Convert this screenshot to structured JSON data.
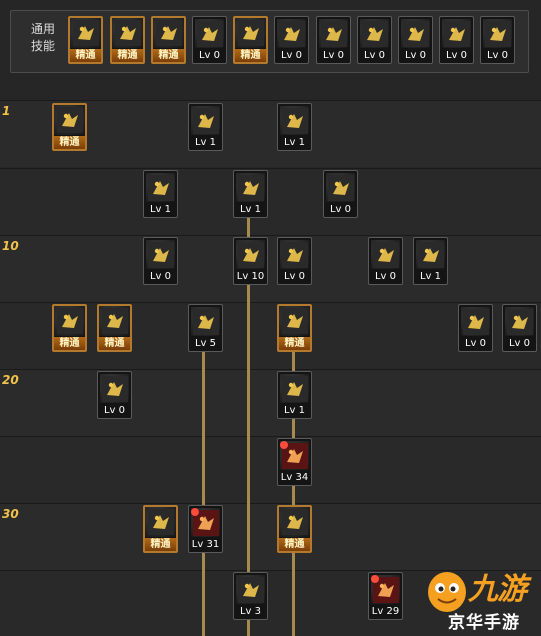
{
  "common_skills": {
    "label": "通用\n技能",
    "skills": [
      {
        "icon": "acrobat-icon",
        "tag": "精通",
        "mastered": true
      },
      {
        "icon": "leap-kick-icon",
        "tag": "精通",
        "mastered": true
      },
      {
        "icon": "dash-kick-icon",
        "tag": "精通",
        "mastered": true
      },
      {
        "icon": "wings-icon",
        "tag": "Lv 0",
        "mastered": false
      },
      {
        "icon": "target-icon",
        "tag": "精通",
        "mastered": true
      },
      {
        "icon": "crosshair-icon",
        "tag": "Lv 0",
        "mastered": false
      },
      {
        "icon": "grenade-throw-icon",
        "tag": "Lv 0",
        "mastered": false
      },
      {
        "icon": "gear-man-icon",
        "tag": "Lv 0",
        "mastered": false
      },
      {
        "icon": "eye-icon",
        "tag": "Lv 0",
        "mastered": false
      },
      {
        "icon": "aura-man-icon",
        "tag": "Lv 0",
        "mastered": false
      },
      {
        "icon": "whirl-kick-icon",
        "tag": "Lv 0",
        "mastered": false
      }
    ]
  },
  "rows": [
    {
      "level": "1"
    },
    {
      "level": ""
    },
    {
      "level": "10"
    },
    {
      "level": ""
    },
    {
      "level": "20"
    },
    {
      "level": ""
    },
    {
      "level": "30"
    },
    {
      "level": ""
    }
  ],
  "skills": [
    {
      "id": "r1a",
      "icon": "cross-icon",
      "tag": "精通",
      "mastered": true
    },
    {
      "id": "r1b",
      "icon": "kick-arc-icon",
      "tag": "Lv 1",
      "mastered": false
    },
    {
      "id": "r1c",
      "icon": "rising-kick-icon",
      "tag": "Lv 1",
      "mastered": false
    },
    {
      "id": "r2a",
      "icon": "burst-icon",
      "tag": "Lv 1",
      "mastered": false
    },
    {
      "id": "r2b",
      "icon": "bullet-rush-icon",
      "tag": "Lv 1",
      "mastered": false
    },
    {
      "id": "r2c",
      "icon": "turret-icon",
      "tag": "Lv 0",
      "mastered": false
    },
    {
      "id": "r3a",
      "icon": "claw-slash-icon",
      "tag": "Lv 0",
      "mastered": false
    },
    {
      "id": "r3b",
      "icon": "explosion-icon",
      "tag": "Lv 10",
      "mastered": false
    },
    {
      "id": "r3c",
      "icon": "spear-icon",
      "tag": "Lv 0",
      "mastered": false
    },
    {
      "id": "r3d",
      "icon": "upgrade-box-icon",
      "tag": "Lv 0",
      "mastered": false
    },
    {
      "id": "r3e",
      "icon": "spark-hand-icon",
      "tag": "Lv 1",
      "mastered": false
    },
    {
      "id": "r4a",
      "icon": "rifle-icon",
      "tag": "精通",
      "mastered": true
    },
    {
      "id": "r4b",
      "icon": "gatling-icon",
      "tag": "精通",
      "mastered": true
    },
    {
      "id": "r4c",
      "icon": "cannon-icon",
      "tag": "Lv 5",
      "mastered": false
    },
    {
      "id": "r4d",
      "icon": "rocket-icon",
      "tag": "精通",
      "mastered": true
    },
    {
      "id": "r4e",
      "icon": "flag-icon",
      "tag": "Lv 0",
      "mastered": false
    },
    {
      "id": "r4f",
      "icon": "grenade-icon",
      "tag": "Lv 0",
      "mastered": false
    },
    {
      "id": "r5a",
      "icon": "spin-shot-icon",
      "tag": "Lv 0",
      "mastered": false
    },
    {
      "id": "r5b",
      "icon": "eye-slash-icon",
      "tag": "Lv 1",
      "mastered": false
    },
    {
      "id": "r6a",
      "icon": "red-arrow-icon",
      "tag": "Lv 34",
      "mastered": false,
      "sp": true
    },
    {
      "id": "r7a",
      "icon": "plus-gun-icon",
      "tag": "精通",
      "mastered": true
    },
    {
      "id": "r7b",
      "icon": "red-cannon-icon",
      "tag": "Lv 31",
      "mastered": false,
      "sp": true
    },
    {
      "id": "r7c",
      "icon": "star-burst-icon",
      "tag": "精通",
      "mastered": true
    },
    {
      "id": "r8a",
      "icon": "shells-icon",
      "tag": "Lv 3",
      "mastered": false
    },
    {
      "id": "r8b",
      "icon": "red-swirl-icon",
      "tag": "Lv 29",
      "mastered": false,
      "sp": true
    }
  ],
  "watermark": {
    "logo_text": "九游",
    "caption": "京华手游"
  },
  "colors": {
    "accent": "#f0c24a",
    "mastered_border": "#b37a2e",
    "connector": "#a78a4e"
  }
}
